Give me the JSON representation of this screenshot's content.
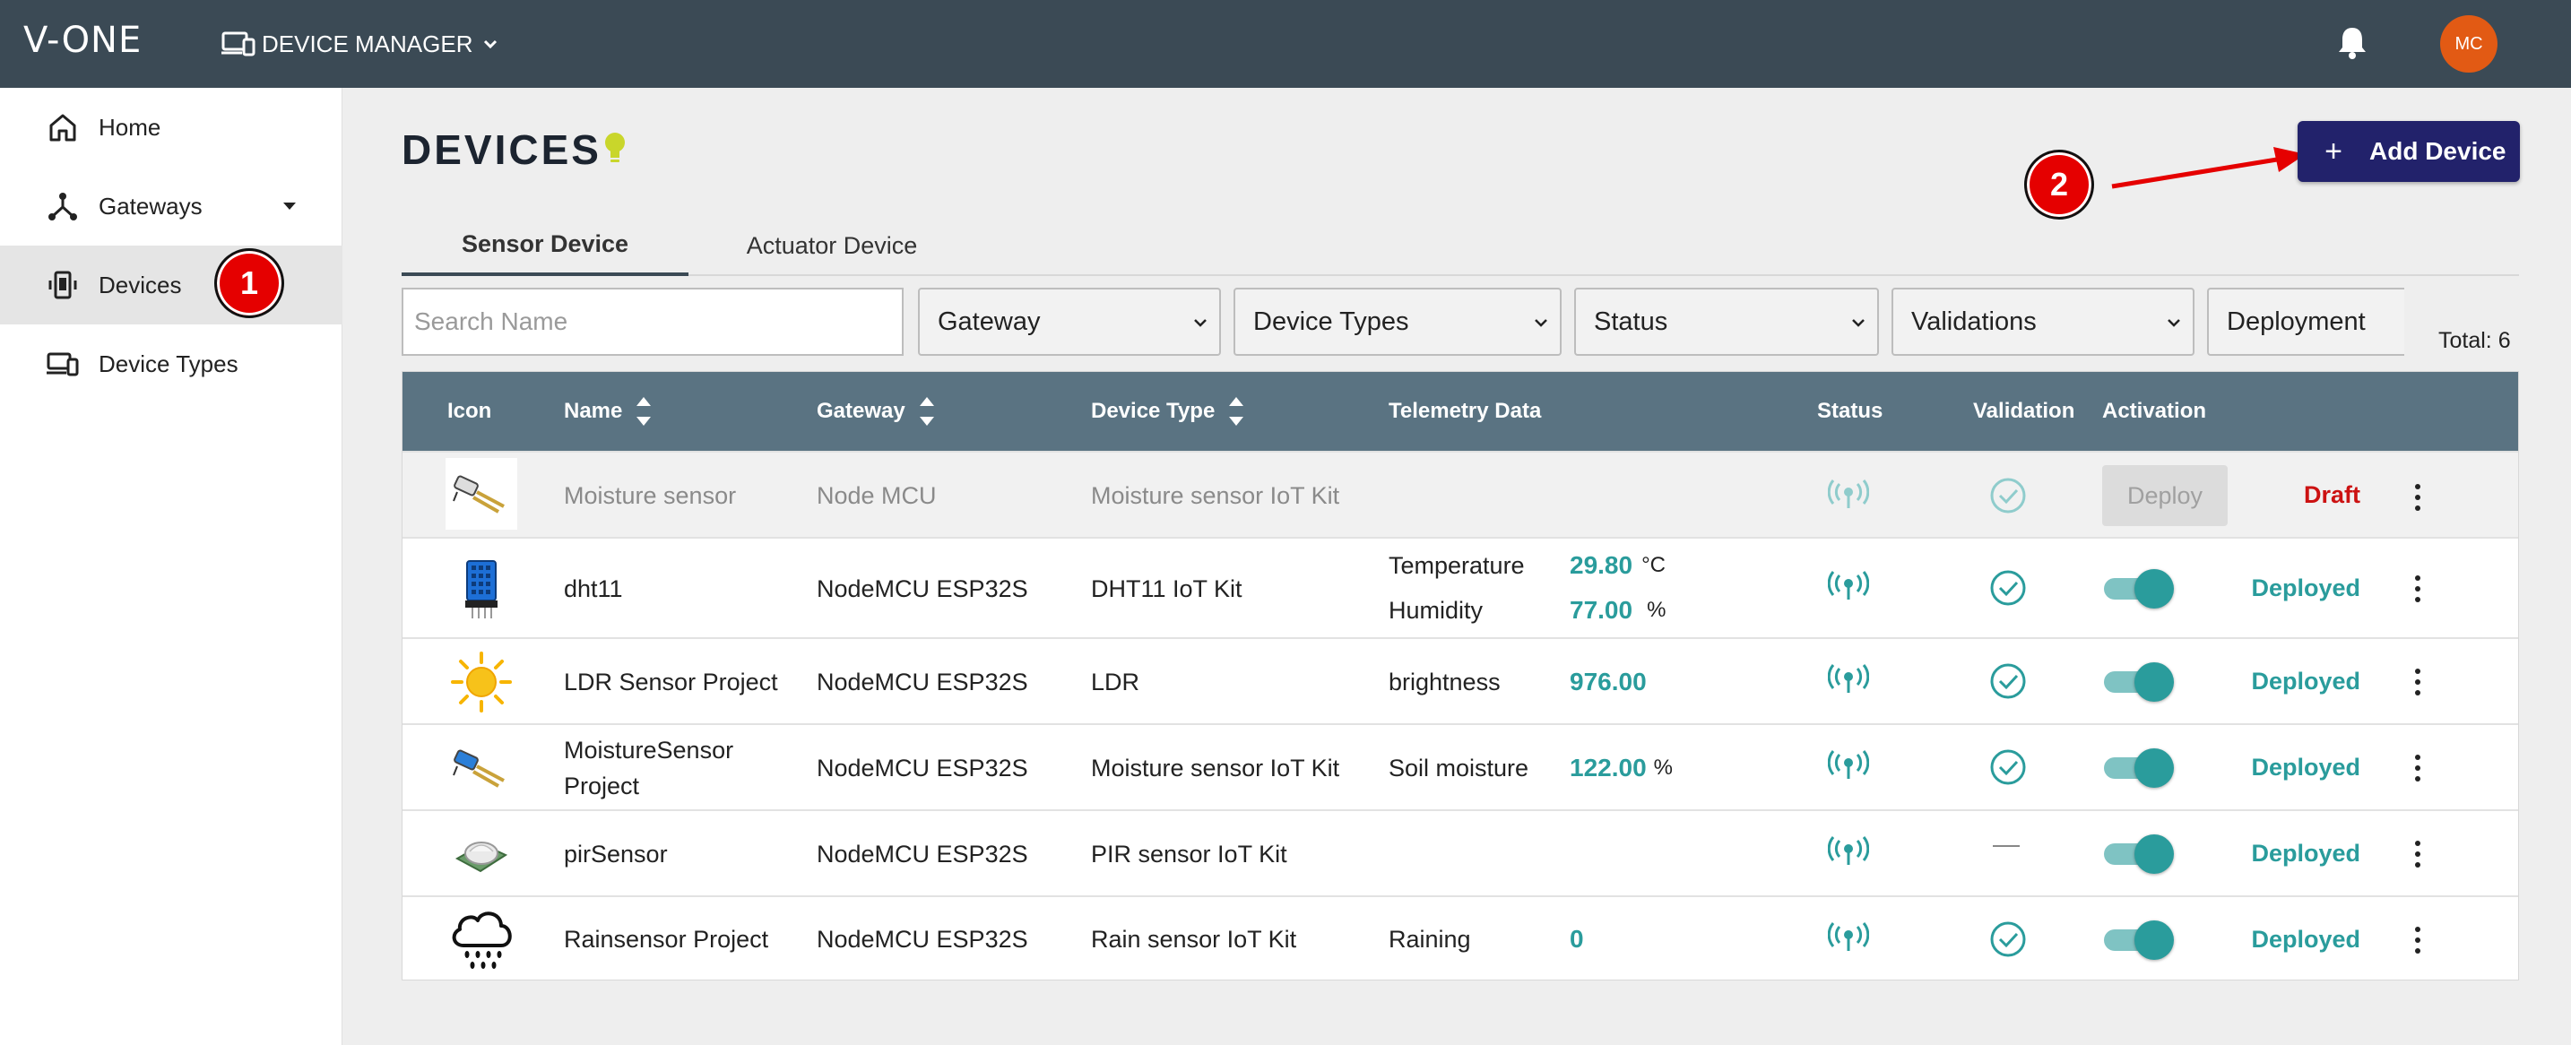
{
  "topbar": {
    "logo": "V-ONE",
    "module_label": "DEVICE MANAGER",
    "avatar_initials": "MC"
  },
  "sidebar": {
    "items": [
      {
        "label": "Home",
        "icon": "home-icon"
      },
      {
        "label": "Gateways",
        "icon": "gateway-icon"
      },
      {
        "label": "Devices",
        "icon": "device-icon",
        "active": true
      },
      {
        "label": "Device Types",
        "icon": "device-types-icon"
      }
    ]
  },
  "callouts": {
    "one": "1",
    "two": "2"
  },
  "page": {
    "title": "DEVICES",
    "add_button_label": "Add Device"
  },
  "tabs": [
    {
      "label": "Sensor Device",
      "active": true
    },
    {
      "label": "Actuator Device",
      "active": false
    }
  ],
  "filters": {
    "search_placeholder": "Search Name",
    "gateway": "Gateway",
    "device_types": "Device Types",
    "status": "Status",
    "validations": "Validations",
    "deployment": "Deployment",
    "total": "Total: 6"
  },
  "table": {
    "headers": {
      "icon": "Icon",
      "name": "Name",
      "gateway": "Gateway",
      "device_type": "Device Type",
      "telemetry": "Telemetry Data",
      "status": "Status",
      "validation": "Validation",
      "activation": "Activation"
    },
    "rows": [
      {
        "name": "Moisture sensor",
        "gateway": "Node MCU",
        "device_type": "Moisture sensor IoT Kit",
        "telemetry": [],
        "validated": true,
        "activation": "Deploy",
        "state": "Draft",
        "icon": "moisture-sensor-icon"
      },
      {
        "name": "dht11",
        "gateway": "NodeMCU ESP32S",
        "device_type": "DHT11 IoT Kit",
        "telemetry": [
          {
            "label": "Temperature",
            "value": "29.80",
            "unit": "°C"
          },
          {
            "label": "Humidity",
            "value": "77.00",
            "unit": "%"
          }
        ],
        "validated": true,
        "activation": "on",
        "state": "Deployed",
        "icon": "dht11-sensor-icon"
      },
      {
        "name": "LDR Sensor Project",
        "gateway": "NodeMCU ESP32S",
        "device_type": "LDR",
        "telemetry": [
          {
            "label": "brightness",
            "value": "976.00",
            "unit": ""
          }
        ],
        "validated": true,
        "activation": "on",
        "state": "Deployed",
        "icon": "sun-icon"
      },
      {
        "name": "MoistureSensor",
        "name_line2": "Project",
        "gateway": "NodeMCU ESP32S",
        "device_type": "Moisture sensor IoT Kit",
        "telemetry": [
          {
            "label": "Soil moisture",
            "value": "122.00",
            "unit": "%"
          }
        ],
        "validated": true,
        "activation": "on",
        "state": "Deployed",
        "icon": "moisture-sensor-icon"
      },
      {
        "name": "pirSensor",
        "gateway": "NodeMCU ESP32S",
        "device_type": "PIR sensor IoT Kit",
        "telemetry": [],
        "validated": false,
        "validation_text": "—",
        "activation": "on",
        "state": "Deployed",
        "icon": "pir-sensor-icon"
      },
      {
        "name": "Rainsensor Project",
        "gateway": "NodeMCU ESP32S",
        "device_type": "Rain sensor IoT Kit",
        "telemetry": [
          {
            "label": "Raining",
            "value": "0",
            "unit": ""
          }
        ],
        "validated": true,
        "activation": "on",
        "state": "Deployed",
        "icon": "rain-cloud-icon"
      }
    ]
  },
  "colors": {
    "topbar": "#3b4a55",
    "table_header": "#5a7382",
    "accent_teal": "#2a9c9c",
    "draft_red": "#cc1212",
    "add_button": "#22226b",
    "avatar": "#e25a14",
    "callout": "#e50000"
  }
}
